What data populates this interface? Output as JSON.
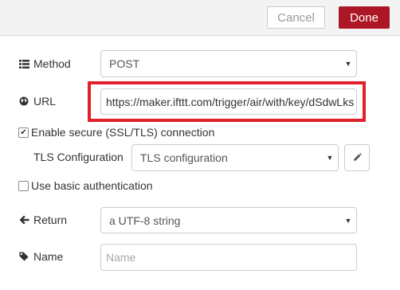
{
  "toolbar": {
    "cancel_label": "Cancel",
    "done_label": "Done"
  },
  "method": {
    "label": "Method",
    "value": "POST",
    "icon": "list-icon"
  },
  "url": {
    "label": "URL",
    "value": "https://maker.ifttt.com/trigger/air/with/key/dSdwLks",
    "icon": "globe-icon"
  },
  "ssl": {
    "label": "Enable secure (SSL/TLS) connection",
    "checked": true
  },
  "tls": {
    "label": "TLS Configuration",
    "value": "TLS configuration",
    "edit_icon": "pencil-icon"
  },
  "basic_auth": {
    "label": "Use basic authentication",
    "checked": false
  },
  "return": {
    "label": "Return",
    "value": "a UTF-8 string",
    "icon": "arrow-left-icon"
  },
  "name": {
    "label": "Name",
    "placeholder": "Name",
    "value": "",
    "icon": "tag-icon"
  },
  "colors": {
    "accent": "#ad1625",
    "highlight": "#e0202a"
  }
}
